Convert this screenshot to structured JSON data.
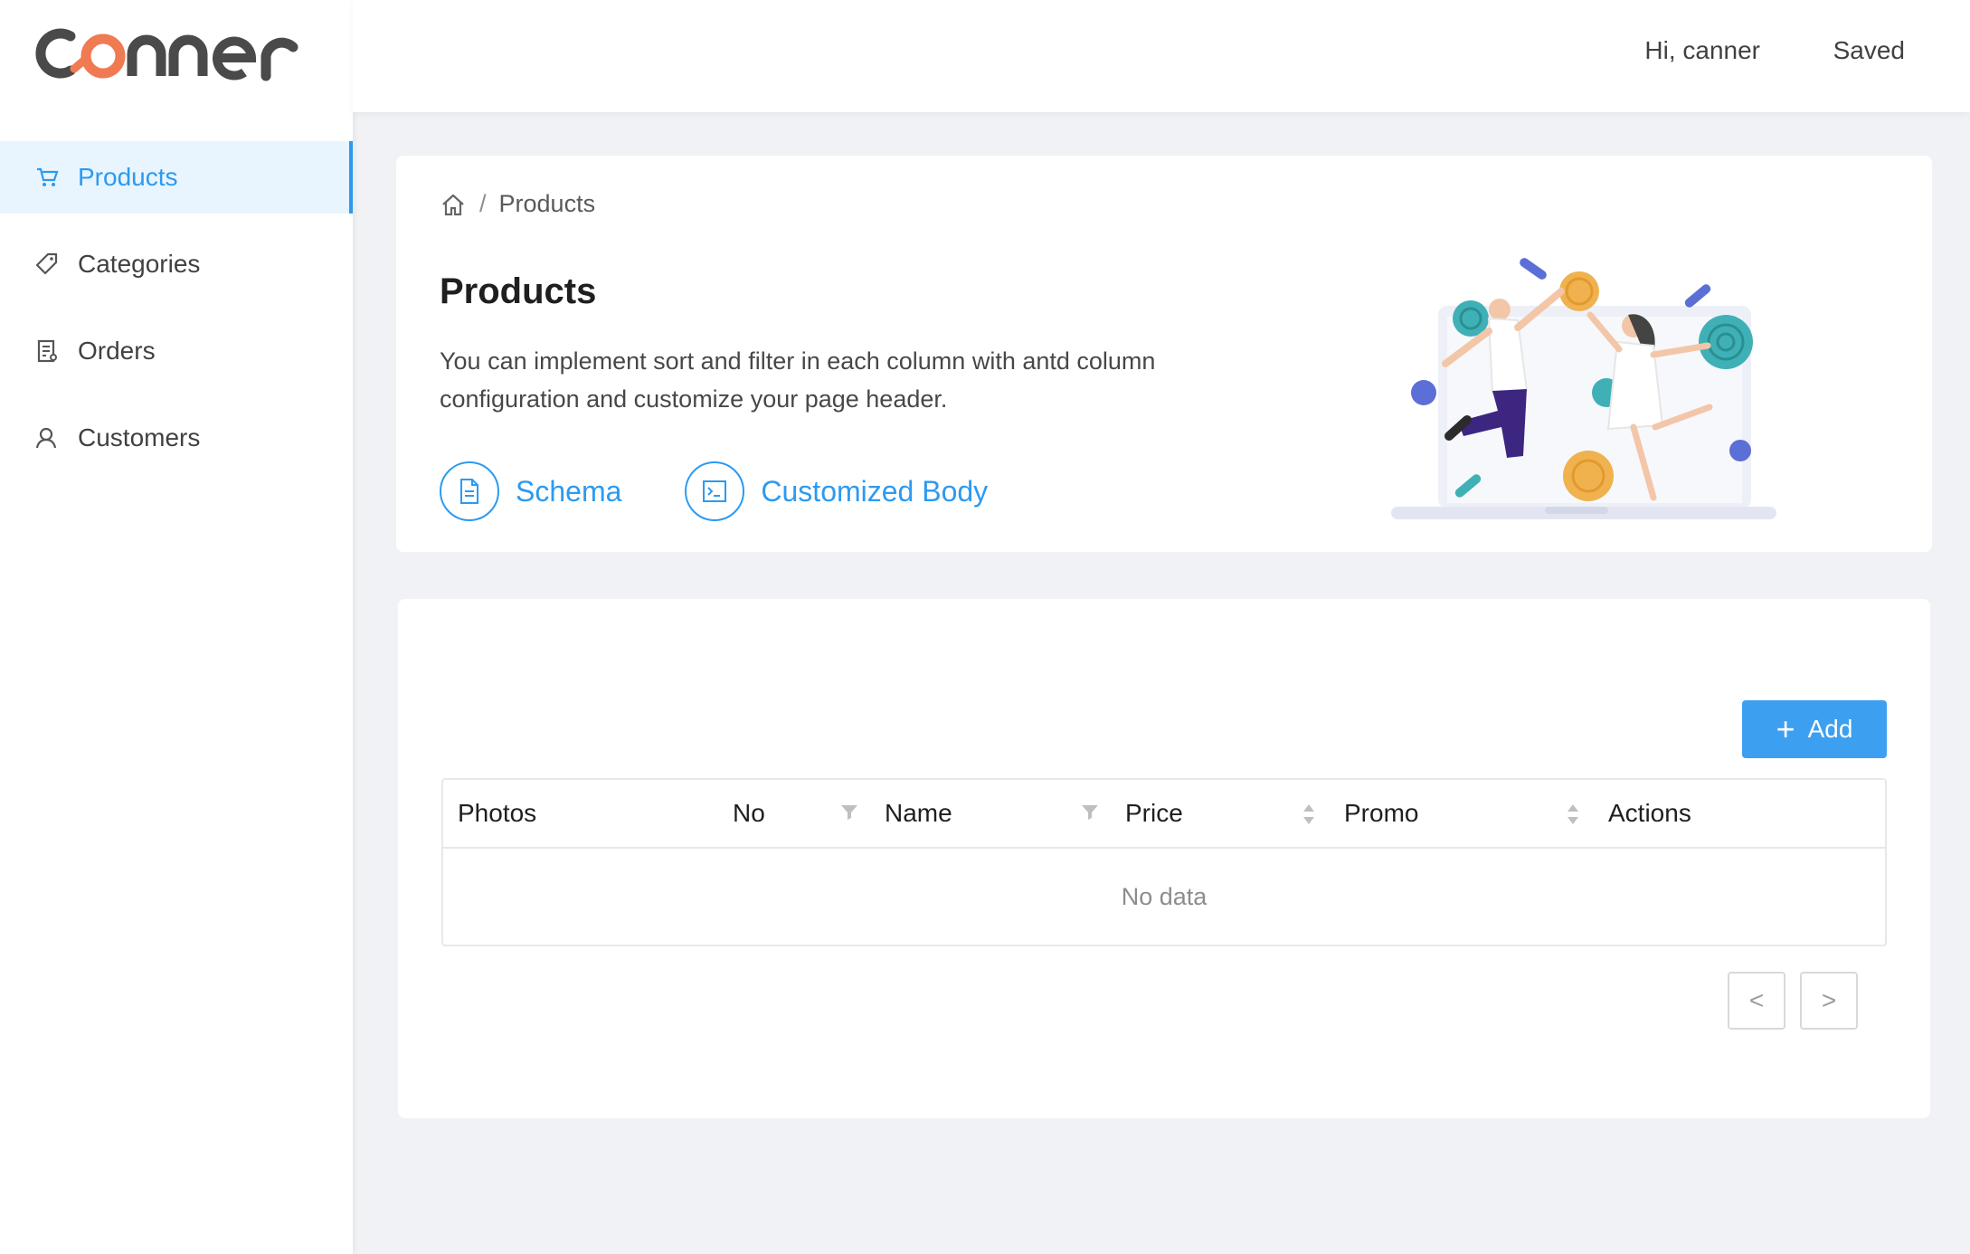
{
  "app": {
    "logo_text": "canner"
  },
  "sidebar": {
    "items": [
      {
        "label": "Products",
        "icon": "cart-icon",
        "active": true
      },
      {
        "label": "Categories",
        "icon": "tag-icon",
        "active": false
      },
      {
        "label": "Orders",
        "icon": "receipt-icon",
        "active": false
      },
      {
        "label": "Customers",
        "icon": "user-icon",
        "active": false
      }
    ]
  },
  "header": {
    "greeting": "Hi, canner",
    "status": "Saved"
  },
  "page_header": {
    "breadcrumb": {
      "home_icon": "home-icon",
      "separator": "/",
      "current": "Products"
    },
    "title": "Products",
    "description": "You can implement sort and filter in each column with antd column configuration and customize your page header.",
    "links": [
      {
        "label": "Schema",
        "icon": "file-icon"
      },
      {
        "label": "Customized Body",
        "icon": "code-icon"
      }
    ]
  },
  "table": {
    "add_label": "Add",
    "columns": [
      {
        "label": "Photos",
        "control": null
      },
      {
        "label": "No",
        "control": "filter-icon"
      },
      {
        "label": "Name",
        "control": "filter-icon"
      },
      {
        "label": "Price",
        "control": "sort-icon"
      },
      {
        "label": "Promo",
        "control": "sort-icon"
      },
      {
        "label": "Actions",
        "control": null
      }
    ],
    "empty_text": "No data",
    "pagination": {
      "prev": "<",
      "next": ">"
    }
  },
  "colors": {
    "accent": "#2c9af0",
    "button": "#3d9ff0",
    "logo_dark": "#4a4a4a",
    "logo_accent": "#f07a52",
    "background": "#f0f2f5"
  }
}
